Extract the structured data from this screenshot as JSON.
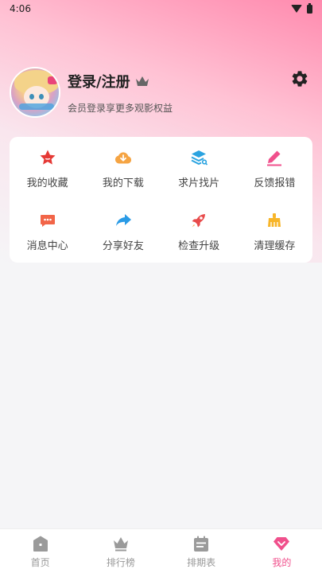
{
  "status_bar": {
    "time": "4:06"
  },
  "profile": {
    "title": "登录/注册",
    "subtitle": "会员登录享更多观影权益"
  },
  "grid": [
    {
      "label": "我的收藏",
      "icon": "star-icon",
      "color": "#e53935"
    },
    {
      "label": "我的下载",
      "icon": "download-icon",
      "color": "#f5a443"
    },
    {
      "label": "求片找片",
      "icon": "layers-search-icon",
      "color": "#2aa3e0"
    },
    {
      "label": "反馈报错",
      "icon": "edit-icon",
      "color": "#f0508c"
    },
    {
      "label": "消息中心",
      "icon": "message-icon",
      "color": "#f26548"
    },
    {
      "label": "分享好友",
      "icon": "share-icon",
      "color": "#2a9be6"
    },
    {
      "label": "检查升级",
      "icon": "rocket-icon",
      "color": "#e84b4b"
    },
    {
      "label": "清理缓存",
      "icon": "broom-icon",
      "color": "#f7b529"
    }
  ],
  "tabs": [
    {
      "label": "首页",
      "icon": "home-icon"
    },
    {
      "label": "排行榜",
      "icon": "crown-icon"
    },
    {
      "label": "排期表",
      "icon": "calendar-icon"
    },
    {
      "label": "我的",
      "icon": "diamond-icon",
      "active": true
    }
  ],
  "colors": {
    "accent": "#f0508c",
    "inactive": "#999999"
  }
}
